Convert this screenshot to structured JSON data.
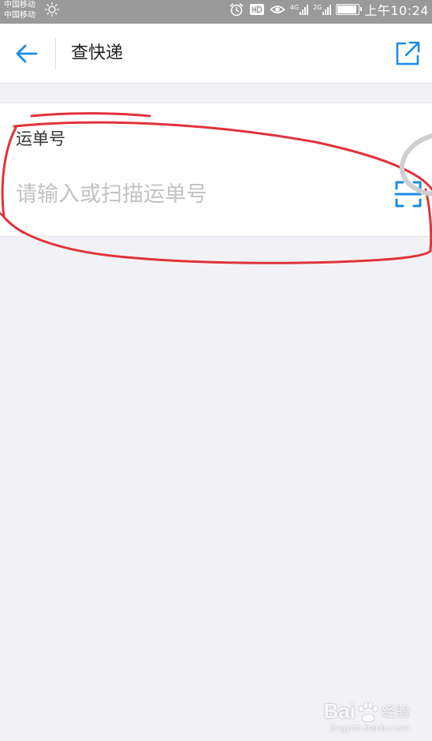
{
  "status_bar": {
    "carrier_1": "中国移动",
    "carrier_2": "中国移动",
    "network_1": "4G",
    "network_2": "2G",
    "battery_level": 0.9,
    "time": "上午10:24",
    "icons": [
      "weather-sun-icon",
      "alarm-clock-icon",
      "hd-icon",
      "eye-icon",
      "signal-icon",
      "battery-icon"
    ]
  },
  "title_bar": {
    "title": "查快递",
    "back_icon": "arrow-left-icon",
    "share_icon": "share-external-icon",
    "accent_color": "#1a8ce6"
  },
  "form": {
    "label": "运单号",
    "input_value": "",
    "input_placeholder": "请输入或扫描运单号",
    "scan_icon": "scan-frame-icon"
  },
  "annotation": {
    "color": "#e0333a"
  },
  "watermark": {
    "brand": "Bai",
    "suffix": "经验",
    "url": "jingyan.baidu.com"
  }
}
